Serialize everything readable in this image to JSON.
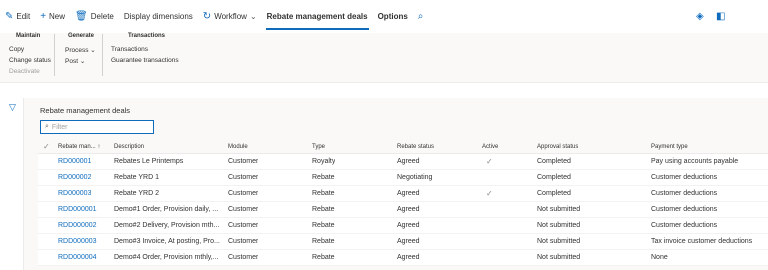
{
  "toolbar": {
    "edit": "Edit",
    "new": "New",
    "delete": "Delete",
    "display_dimensions": "Display dimensions",
    "workflow": "Workflow",
    "tab_rebate": "Rebate management deals",
    "tab_options": "Options"
  },
  "ribbon": {
    "maintain": {
      "title": "Maintain",
      "items": [
        "Copy",
        "Change status",
        "Deactivate"
      ]
    },
    "generate": {
      "title": "Generate",
      "items": [
        "Process",
        "Post"
      ]
    },
    "transactions": {
      "title": "Transactions",
      "items": [
        "Transactions",
        "Guarantee transactions"
      ]
    }
  },
  "grid": {
    "title": "Rebate management deals",
    "filter_placeholder": "Filter",
    "columns": [
      "Rebate man...",
      "Description",
      "Module",
      "Type",
      "Rebate status",
      "Active",
      "Approval status",
      "Payment type"
    ],
    "rows": [
      {
        "id": "RD000001",
        "description": "Rebates Le Printemps",
        "module": "Customer",
        "type": "Royalty",
        "status": "Agreed",
        "active": true,
        "approval": "Completed",
        "payment": "Pay using accounts payable"
      },
      {
        "id": "RD000002",
        "description": "Rebate YRD 1",
        "module": "Customer",
        "type": "Rebate",
        "status": "Negotiating",
        "active": false,
        "approval": "Completed",
        "payment": "Customer deductions"
      },
      {
        "id": "RD000003",
        "description": "Rebate YRD 2",
        "module": "Customer",
        "type": "Rebate",
        "status": "Agreed",
        "active": true,
        "approval": "Completed",
        "payment": "Customer deductions"
      },
      {
        "id": "RDD000001",
        "description": "Demo#1 Order, Provision daily, ...",
        "module": "Customer",
        "type": "Rebate",
        "status": "Agreed",
        "active": false,
        "approval": "Not submitted",
        "payment": "Customer deductions"
      },
      {
        "id": "RDD000002",
        "description": "Demo#2 Delivery, Provision mth...",
        "module": "Customer",
        "type": "Rebate",
        "status": "Agreed",
        "active": false,
        "approval": "Not submitted",
        "payment": "Customer deductions"
      },
      {
        "id": "RDD000003",
        "description": "Demo#3 Invoice, At posting, Pro...",
        "module": "Customer",
        "type": "Rebate",
        "status": "Agreed",
        "active": false,
        "approval": "Not submitted",
        "payment": "Tax invoice customer deductions"
      },
      {
        "id": "RDD000004",
        "description": "Demo#4 Order, Provision mthly,...",
        "module": "Customer",
        "type": "Rebate",
        "status": "Agreed",
        "active": false,
        "approval": "Not submitted",
        "payment": "None"
      }
    ]
  }
}
